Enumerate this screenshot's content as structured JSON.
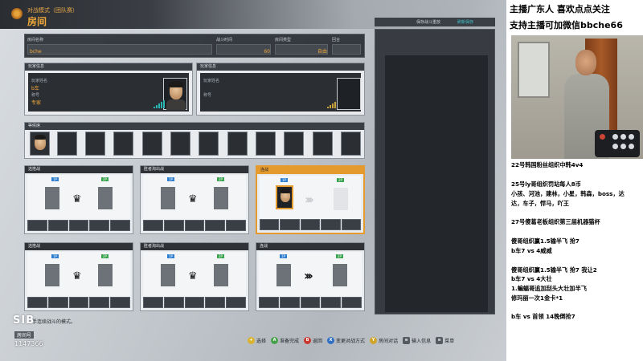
{
  "header": {
    "mode": "对战模式（团队赛）",
    "title": "房间"
  },
  "room": {
    "name_label": "房间名称",
    "name": "bche",
    "time_label": "战斗时间",
    "time": "60",
    "type_label": "房间类型",
    "type": "自由",
    "round_label": "回合"
  },
  "players": {
    "left": {
      "header": "玩家信息",
      "line1": "玩家姓名",
      "name": "b车",
      "line3": "称号",
      "rank": "专家"
    },
    "right": {
      "header": "玩家信息",
      "line1": "玩家姓名",
      "line2": "称号"
    }
  },
  "spectators": {
    "header": "等候席"
  },
  "matches": [
    {
      "title": "选搭战",
      "left_tag": "1P",
      "right_tag": "2P"
    },
    {
      "title": "胜者淘出战",
      "left_tag": "1P",
      "right_tag": "2P"
    },
    {
      "title": "连战",
      "left_tag": "1P",
      "right_tag": "2P"
    },
    {
      "title": "选搭战",
      "left_tag": "1P",
      "right_tag": "2P"
    },
    {
      "title": "胜者淘出战",
      "left_tag": "1P",
      "right_tag": "2P"
    },
    {
      "title": "连战",
      "left_tag": "1P",
      "right_tag": "2P"
    }
  ],
  "save_panel": {
    "label": "保存战斗重放",
    "refresh": "刷新保存"
  },
  "bottom": {
    "hint": "手连续战斗的模式。",
    "logo": "SIB",
    "room_label": "房间号",
    "room_number": "1147366",
    "buttons": [
      {
        "key": "+",
        "label": "选择",
        "color": "#d9b332"
      },
      {
        "key": "A",
        "label": "准备完成",
        "color": "#46a04a"
      },
      {
        "key": "B",
        "label": "返回",
        "color": "#c9382f"
      },
      {
        "key": "X",
        "label": "变更对战方式",
        "color": "#2f6fc4"
      },
      {
        "key": "Y",
        "label": "房间对话",
        "color": "#cfa52a"
      },
      {
        "key": "≡",
        "label": "输入信息",
        "color": "#555a61"
      },
      {
        "key": "≡",
        "label": "菜单",
        "color": "#555a61"
      }
    ]
  },
  "overlay": {
    "line1": "主播广东人 喜欢点点关注",
    "line2": "支持主播可加微信bbche66",
    "notes": [
      "22号韩国粉丝组织中韩4v4",
      "25号ly哥组织罚站每人8币",
      "小孩、河池，建林，小星，韩森，boss，达",
      "达，车子，悍马，吖王",
      "27号傻葛老板组织第三届机器猫杯",
      "傻哥组织赢1.5输半飞 抢7",
      "b车7  vs  4威威",
      "傻哥组织赢1.5输半飞 抢7 我让2",
      "b车7  vs  4大壮",
      "1.蝙蝠哥追加刮头大壮加半飞",
      "   修玛丽一次1金卡*1",
      "b车  vs  首领  14晚倒抢7"
    ]
  }
}
